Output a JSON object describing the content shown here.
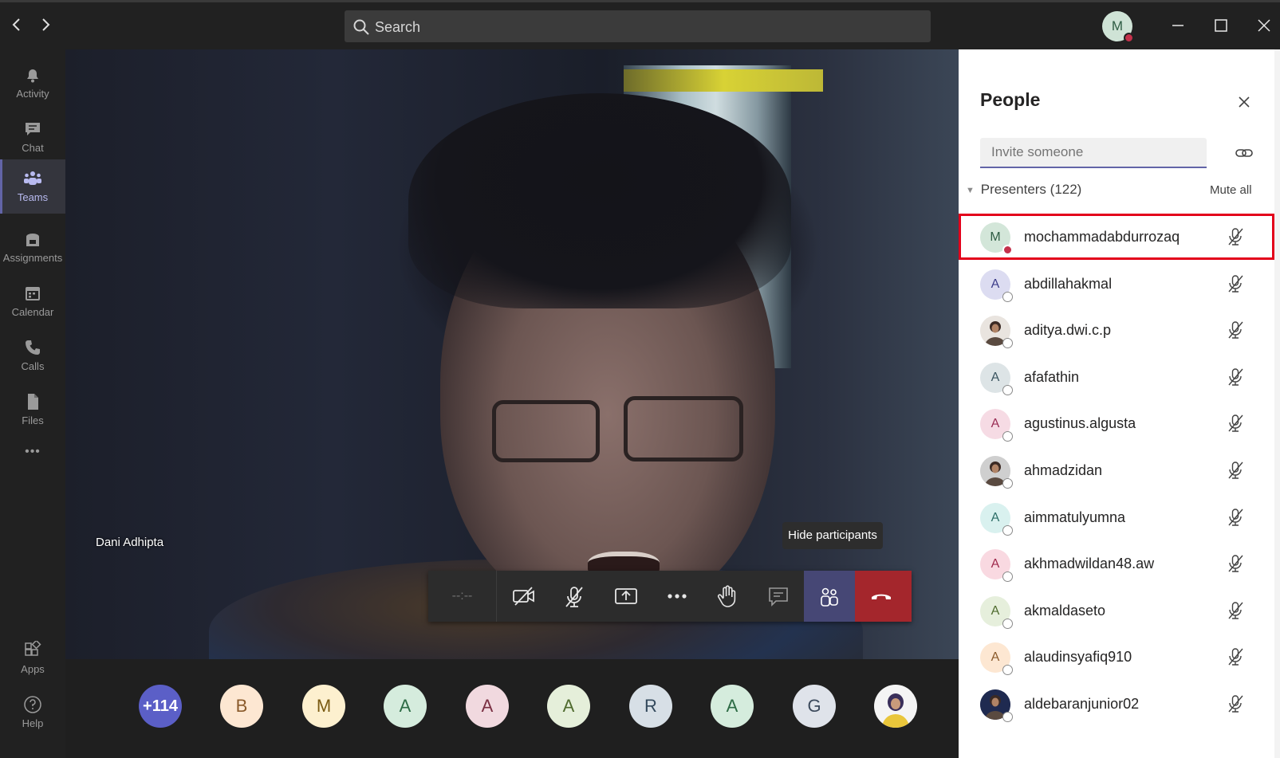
{
  "titlebar": {
    "back_icon": "chevron-left-icon",
    "forward_icon": "chevron-right-icon",
    "search_placeholder": "Search",
    "me_initial": "M",
    "me_status_color": "#c4314b"
  },
  "rail": {
    "items": [
      {
        "label": "Activity",
        "icon": "bell-icon"
      },
      {
        "label": "Chat",
        "icon": "chat-icon"
      },
      {
        "label": "Teams",
        "icon": "teams-icon"
      },
      {
        "label": "Assignments",
        "icon": "assignments-icon"
      },
      {
        "label": "Calendar",
        "icon": "calendar-icon"
      },
      {
        "label": "Calls",
        "icon": "phone-icon"
      },
      {
        "label": "Files",
        "icon": "files-icon"
      }
    ],
    "active": "Teams",
    "more": "•••",
    "bottom": [
      {
        "label": "Apps",
        "icon": "apps-icon"
      },
      {
        "label": "Help",
        "icon": "help-icon"
      }
    ]
  },
  "video": {
    "speaker_name": "Dani Adhipta"
  },
  "controls": {
    "timer": "--:--",
    "tooltip": "Hide participants",
    "buttons": [
      "camera-off-icon",
      "mic-off-icon",
      "share-screen-icon",
      "more-icon",
      "raise-hand-icon",
      "chat-icon",
      "participants-icon",
      "hang-up-icon"
    ],
    "accent": "#464775",
    "hangup_color": "#a4262c"
  },
  "strip": {
    "more_count": "+114",
    "avatars": [
      {
        "initial": "B",
        "bg": "#fde7d2",
        "fg": "#8a5a2b"
      },
      {
        "initial": "M",
        "bg": "#fdf0cf",
        "fg": "#7a5a12"
      },
      {
        "initial": "A",
        "bg": "#d5ecdd",
        "fg": "#2d6b45"
      },
      {
        "initial": "A",
        "bg": "#f1d9df",
        "fg": "#7a2f42"
      },
      {
        "initial": "A",
        "bg": "#e5efda",
        "fg": "#4f6b2e"
      },
      {
        "initial": "R",
        "bg": "#d7dfe6",
        "fg": "#33495c"
      },
      {
        "initial": "A",
        "bg": "#d5ecdd",
        "fg": "#2d6b45"
      },
      {
        "initial": "G",
        "bg": "#dfe3ea",
        "fg": "#3c4a5c"
      },
      {
        "initial": "",
        "bg": "#ffffff",
        "fg": "#000000",
        "photo": true
      }
    ]
  },
  "people": {
    "title": "People",
    "invite_placeholder": "Invite someone",
    "section_label": "Presenters (122)",
    "mute_all": "Mute all",
    "list": [
      {
        "name": "mochammadabdurrozaq",
        "initial": "M",
        "bg": "#d3e6d9",
        "fg": "#2f5d44",
        "status": "busy",
        "highlight": true
      },
      {
        "name": "abdillahakmal",
        "initial": "A",
        "bg": "#dcdcf1",
        "fg": "#3d3d8a",
        "status": "offline"
      },
      {
        "name": "aditya.dwi.c.p",
        "initial": "",
        "bg": "#e9e4df",
        "fg": "#000000",
        "status": "offline",
        "photo": true
      },
      {
        "name": "afafathin",
        "initial": "A",
        "bg": "#dde4e6",
        "fg": "#3b5560",
        "status": "offline"
      },
      {
        "name": "agustinus.algusta",
        "initial": "A",
        "bg": "#f6dbe4",
        "fg": "#9a2d55",
        "status": "offline"
      },
      {
        "name": "ahmadzidan",
        "initial": "",
        "bg": "#cfcfcf",
        "fg": "#000000",
        "status": "offline",
        "photo": true
      },
      {
        "name": "aimmatulyumna",
        "initial": "A",
        "bg": "#d9f1ef",
        "fg": "#2d6e68",
        "status": "offline"
      },
      {
        "name": "akhmadwildan48.aw",
        "initial": "A",
        "bg": "#f9d9e1",
        "fg": "#a02b4d",
        "status": "offline"
      },
      {
        "name": "akmaldaseto",
        "initial": "A",
        "bg": "#e6efdc",
        "fg": "#4f6b2e",
        "status": "offline"
      },
      {
        "name": "alaudinsyafiq910",
        "initial": "A",
        "bg": "#fde7d2",
        "fg": "#8a5a2b",
        "status": "offline"
      },
      {
        "name": "aldebaranjunior02",
        "initial": "",
        "bg": "#1f2a50",
        "fg": "#ffffff",
        "status": "offline",
        "photo": true
      }
    ]
  }
}
